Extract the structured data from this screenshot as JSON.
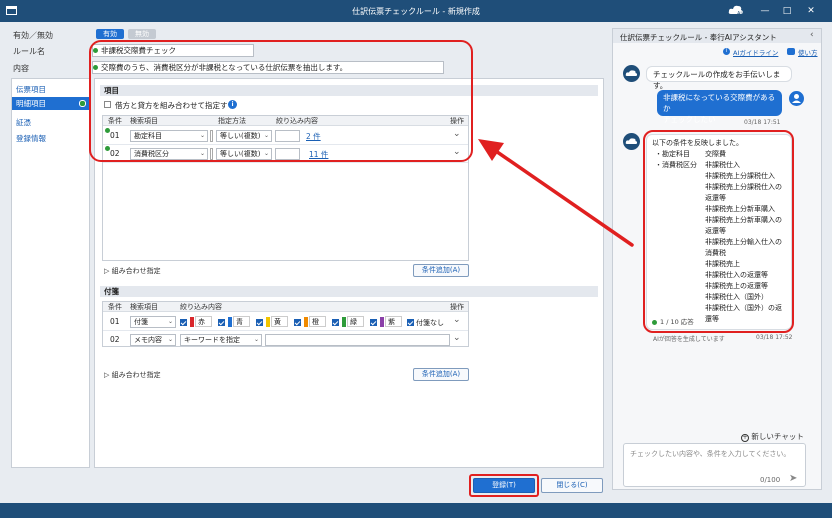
{
  "window": {
    "title": "仕訳伝票チェックルール - 新規作成"
  },
  "toggle": {
    "label": "有効／無効",
    "on": "有効",
    "off": "無効"
  },
  "rule_name": {
    "label": "ルール名",
    "value": "非課税交際費チェック"
  },
  "content": {
    "label": "内容",
    "value": "交際費のうち、消費税区分が非課税となっている仕訳伝票を抽出します。"
  },
  "sidebar": {
    "items": [
      {
        "label": "伝票項目"
      },
      {
        "label": "明細項目"
      },
      {
        "label": "証憑"
      },
      {
        "label": "登録情報"
      }
    ]
  },
  "items_section": {
    "title": "項目",
    "combine_label": "借方と貸方を組み合わせて指定する",
    "headers": {
      "cond": "条件",
      "item": "検索項目",
      "method": "指定方法",
      "filter": "絞り込み内容",
      "ops": "操作"
    },
    "rows": [
      {
        "num": "01",
        "item": "勘定科目",
        "method": "等しい(複数)",
        "link": "2 件"
      },
      {
        "num": "02",
        "item": "消費税区分",
        "method": "等しい(複数)",
        "link": "11 件"
      }
    ],
    "combine_spec": "組み合わせ指定",
    "add_condition": "条件追加(A)"
  },
  "tag_section": {
    "title": "付箋",
    "headers": {
      "cond": "条件",
      "item": "検索項目",
      "filter": "絞り込み内容",
      "ops": "操作"
    },
    "rows": [
      {
        "num": "01",
        "item": "付箋",
        "colors": [
          {
            "name": "赤",
            "color": "#d9262b"
          },
          {
            "name": "青",
            "color": "#1f6fd1"
          },
          {
            "name": "黄",
            "color": "#f2c500"
          },
          {
            "name": "橙",
            "color": "#f08a00"
          },
          {
            "name": "緑",
            "color": "#2e9b3a"
          },
          {
            "name": "紫",
            "color": "#8a3fa8"
          }
        ],
        "none": "付箋なし"
      },
      {
        "num": "02",
        "item": "メモ内容",
        "method": "キーワードを指定"
      }
    ],
    "combine_spec": "組み合わせ指定",
    "add_condition": "条件追加(A)"
  },
  "footer": {
    "register": "登録(T)",
    "close": "閉じる(C)"
  },
  "assistant": {
    "title": "仕訳伝票チェックルール - 奉行AIアシスタント",
    "guide": "AIガイドライン",
    "howto": "使い方",
    "msg1": "チェックルールの作成をお手伝いします。",
    "user_msg_l1": "非課税になっている交際費があるか",
    "user_msg_l2": "チェックしたい",
    "user_time": "03/18 17:51",
    "reply_intro": "以下の条件を反映しました。",
    "reply_k1": "・勘定科目",
    "reply_v1": "交際費",
    "reply_k2": "・消費税区分",
    "reply_v2": [
      "非課税仕入",
      "非課税売上分課税仕入",
      "非課税売上分課税仕入の",
      "返還等",
      "非課税売上分新車購入",
      "非課税売上分新車購入の",
      "返還等",
      "非課税売上分輸入仕入の",
      "消費税",
      "非課税売上",
      "非課税仕入の返還等",
      "非課税売上の返還等",
      "非課税仕入（国外）",
      "非課税仕入（国外）の返",
      "還等"
    ],
    "reply_count": "1 / 10 応答",
    "ai_note": "AIが回答を生成しています",
    "reply_time": "03/18 17:52",
    "new_chat": "新しいチャット",
    "placeholder": "チェックしたい内容や、条件を入力してください。",
    "counter": "0/100"
  },
  "colors": {
    "titlebar": "#1f4e79",
    "accent": "#1a5fb4",
    "highlight": "#e02020",
    "active": "#1f6fd1"
  }
}
